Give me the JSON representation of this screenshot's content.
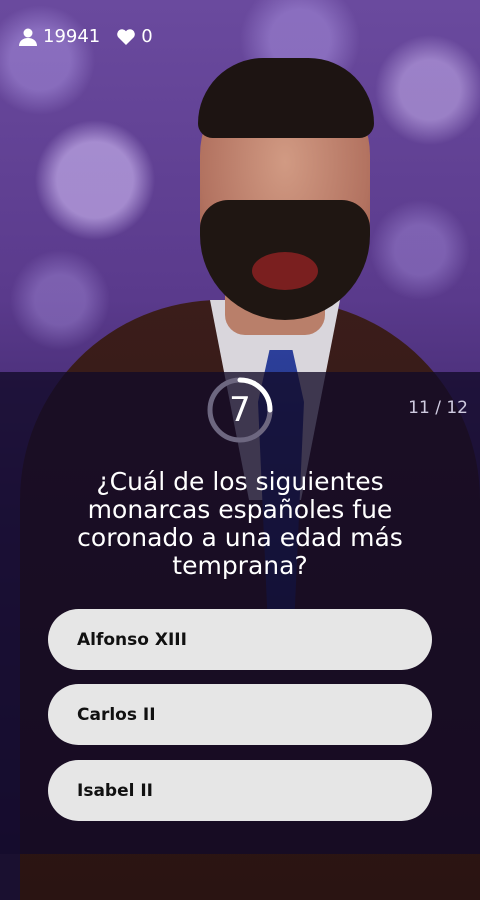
{
  "stats": {
    "players": "19941",
    "lives": "0"
  },
  "timer": {
    "value": "7"
  },
  "progress": {
    "current": "11",
    "separator": "/",
    "total": "12"
  },
  "question": {
    "text": "¿Cuál de los siguientes monarcas españoles fue coronado a una edad más temprana?"
  },
  "answers": [
    {
      "label": "Alfonso XIII"
    },
    {
      "label": "Carlos II"
    },
    {
      "label": "Isabel II"
    }
  ],
  "icons": {
    "players": "person-icon",
    "lives": "heart-icon"
  }
}
